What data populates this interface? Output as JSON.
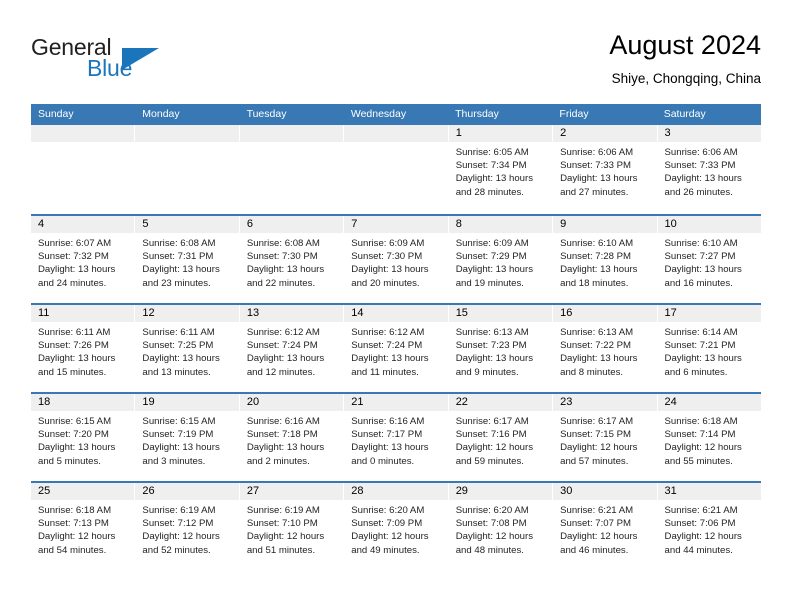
{
  "brand": {
    "name_top": "General",
    "name_bottom": "Blue",
    "logo_icon": "triangle-logo-icon",
    "accent_color": "#1b75bb"
  },
  "header": {
    "title": "August 2024",
    "subtitle": "Shiye, Chongqing, China"
  },
  "theme": {
    "header_bar_color": "#3878b4",
    "daynum_band_color": "#efefef",
    "text_color": "#231f20"
  },
  "calendar": {
    "weekdays": [
      "Sunday",
      "Monday",
      "Tuesday",
      "Wednesday",
      "Thursday",
      "Friday",
      "Saturday"
    ],
    "weeks": [
      [
        {
          "day": "",
          "empty": true
        },
        {
          "day": "",
          "empty": true
        },
        {
          "day": "",
          "empty": true
        },
        {
          "day": "",
          "empty": true
        },
        {
          "day": "1",
          "sunrise": "Sunrise: 6:05 AM",
          "sunset": "Sunset: 7:34 PM",
          "daylight": "Daylight: 13 hours and 28 minutes."
        },
        {
          "day": "2",
          "sunrise": "Sunrise: 6:06 AM",
          "sunset": "Sunset: 7:33 PM",
          "daylight": "Daylight: 13 hours and 27 minutes."
        },
        {
          "day": "3",
          "sunrise": "Sunrise: 6:06 AM",
          "sunset": "Sunset: 7:33 PM",
          "daylight": "Daylight: 13 hours and 26 minutes."
        }
      ],
      [
        {
          "day": "4",
          "sunrise": "Sunrise: 6:07 AM",
          "sunset": "Sunset: 7:32 PM",
          "daylight": "Daylight: 13 hours and 24 minutes."
        },
        {
          "day": "5",
          "sunrise": "Sunrise: 6:08 AM",
          "sunset": "Sunset: 7:31 PM",
          "daylight": "Daylight: 13 hours and 23 minutes."
        },
        {
          "day": "6",
          "sunrise": "Sunrise: 6:08 AM",
          "sunset": "Sunset: 7:30 PM",
          "daylight": "Daylight: 13 hours and 22 minutes."
        },
        {
          "day": "7",
          "sunrise": "Sunrise: 6:09 AM",
          "sunset": "Sunset: 7:30 PM",
          "daylight": "Daylight: 13 hours and 20 minutes."
        },
        {
          "day": "8",
          "sunrise": "Sunrise: 6:09 AM",
          "sunset": "Sunset: 7:29 PM",
          "daylight": "Daylight: 13 hours and 19 minutes."
        },
        {
          "day": "9",
          "sunrise": "Sunrise: 6:10 AM",
          "sunset": "Sunset: 7:28 PM",
          "daylight": "Daylight: 13 hours and 18 minutes."
        },
        {
          "day": "10",
          "sunrise": "Sunrise: 6:10 AM",
          "sunset": "Sunset: 7:27 PM",
          "daylight": "Daylight: 13 hours and 16 minutes."
        }
      ],
      [
        {
          "day": "11",
          "sunrise": "Sunrise: 6:11 AM",
          "sunset": "Sunset: 7:26 PM",
          "daylight": "Daylight: 13 hours and 15 minutes."
        },
        {
          "day": "12",
          "sunrise": "Sunrise: 6:11 AM",
          "sunset": "Sunset: 7:25 PM",
          "daylight": "Daylight: 13 hours and 13 minutes."
        },
        {
          "day": "13",
          "sunrise": "Sunrise: 6:12 AM",
          "sunset": "Sunset: 7:24 PM",
          "daylight": "Daylight: 13 hours and 12 minutes."
        },
        {
          "day": "14",
          "sunrise": "Sunrise: 6:12 AM",
          "sunset": "Sunset: 7:24 PM",
          "daylight": "Daylight: 13 hours and 11 minutes."
        },
        {
          "day": "15",
          "sunrise": "Sunrise: 6:13 AM",
          "sunset": "Sunset: 7:23 PM",
          "daylight": "Daylight: 13 hours and 9 minutes."
        },
        {
          "day": "16",
          "sunrise": "Sunrise: 6:13 AM",
          "sunset": "Sunset: 7:22 PM",
          "daylight": "Daylight: 13 hours and 8 minutes."
        },
        {
          "day": "17",
          "sunrise": "Sunrise: 6:14 AM",
          "sunset": "Sunset: 7:21 PM",
          "daylight": "Daylight: 13 hours and 6 minutes."
        }
      ],
      [
        {
          "day": "18",
          "sunrise": "Sunrise: 6:15 AM",
          "sunset": "Sunset: 7:20 PM",
          "daylight": "Daylight: 13 hours and 5 minutes."
        },
        {
          "day": "19",
          "sunrise": "Sunrise: 6:15 AM",
          "sunset": "Sunset: 7:19 PM",
          "daylight": "Daylight: 13 hours and 3 minutes."
        },
        {
          "day": "20",
          "sunrise": "Sunrise: 6:16 AM",
          "sunset": "Sunset: 7:18 PM",
          "daylight": "Daylight: 13 hours and 2 minutes."
        },
        {
          "day": "21",
          "sunrise": "Sunrise: 6:16 AM",
          "sunset": "Sunset: 7:17 PM",
          "daylight": "Daylight: 13 hours and 0 minutes."
        },
        {
          "day": "22",
          "sunrise": "Sunrise: 6:17 AM",
          "sunset": "Sunset: 7:16 PM",
          "daylight": "Daylight: 12 hours and 59 minutes."
        },
        {
          "day": "23",
          "sunrise": "Sunrise: 6:17 AM",
          "sunset": "Sunset: 7:15 PM",
          "daylight": "Daylight: 12 hours and 57 minutes."
        },
        {
          "day": "24",
          "sunrise": "Sunrise: 6:18 AM",
          "sunset": "Sunset: 7:14 PM",
          "daylight": "Daylight: 12 hours and 55 minutes."
        }
      ],
      [
        {
          "day": "25",
          "sunrise": "Sunrise: 6:18 AM",
          "sunset": "Sunset: 7:13 PM",
          "daylight": "Daylight: 12 hours and 54 minutes."
        },
        {
          "day": "26",
          "sunrise": "Sunrise: 6:19 AM",
          "sunset": "Sunset: 7:12 PM",
          "daylight": "Daylight: 12 hours and 52 minutes."
        },
        {
          "day": "27",
          "sunrise": "Sunrise: 6:19 AM",
          "sunset": "Sunset: 7:10 PM",
          "daylight": "Daylight: 12 hours and 51 minutes."
        },
        {
          "day": "28",
          "sunrise": "Sunrise: 6:20 AM",
          "sunset": "Sunset: 7:09 PM",
          "daylight": "Daylight: 12 hours and 49 minutes."
        },
        {
          "day": "29",
          "sunrise": "Sunrise: 6:20 AM",
          "sunset": "Sunset: 7:08 PM",
          "daylight": "Daylight: 12 hours and 48 minutes."
        },
        {
          "day": "30",
          "sunrise": "Sunrise: 6:21 AM",
          "sunset": "Sunset: 7:07 PM",
          "daylight": "Daylight: 12 hours and 46 minutes."
        },
        {
          "day": "31",
          "sunrise": "Sunrise: 6:21 AM",
          "sunset": "Sunset: 7:06 PM",
          "daylight": "Daylight: 12 hours and 44 minutes."
        }
      ]
    ]
  }
}
